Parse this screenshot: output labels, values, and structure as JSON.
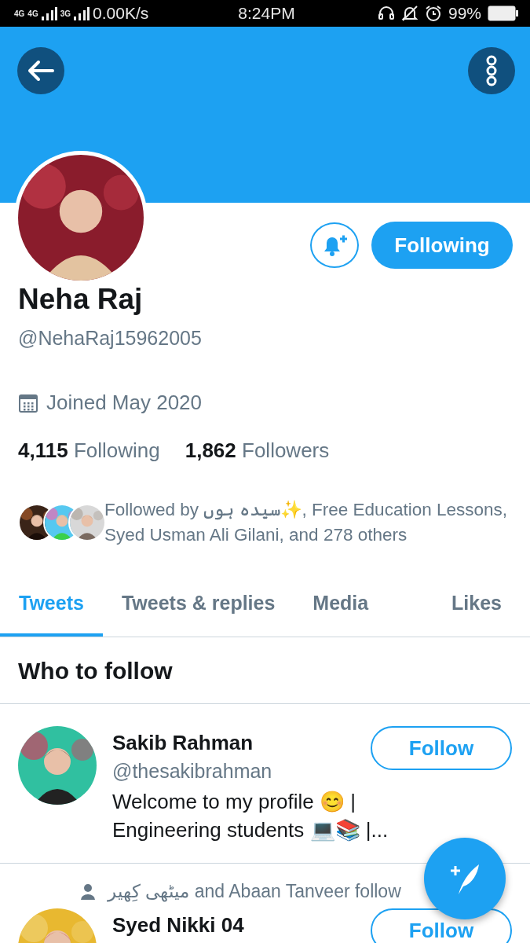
{
  "status_bar": {
    "networks": [
      "4G",
      "4G",
      "3G"
    ],
    "speed": "0.00K/s",
    "time": "8:24PM",
    "battery": "99%"
  },
  "profile": {
    "name": "Neha Raj",
    "handle": "@NehaRaj15962005",
    "joined": "Joined May 2020",
    "follow_button": "Following",
    "stats": [
      {
        "count": "4,115",
        "label": "Following"
      },
      {
        "count": "1,862",
        "label": "Followers"
      }
    ],
    "followed_by": "Followed by سیدہ ہوں✨, Free Education Lessons, Syed Usman Ali Gilani, and 278 others"
  },
  "tabs": [
    {
      "label": "Tweets",
      "selected": true
    },
    {
      "label": "Tweets & replies",
      "selected": false
    },
    {
      "label": "Media",
      "selected": false
    },
    {
      "label": "Likes",
      "selected": false
    }
  ],
  "who_to_follow": {
    "title": "Who to follow",
    "suggestions": [
      {
        "name": "Sakib Rahman",
        "handle": "@thesakibrahman",
        "bio": "Welcome to my profile 😊 | Engineering students 💻📚 |...",
        "button": "Follow"
      },
      {
        "social_context": "میٹھی کِھیر and Abaan Tanveer follow",
        "name": "Syed Nikki 04",
        "button": "Follow"
      }
    ]
  }
}
